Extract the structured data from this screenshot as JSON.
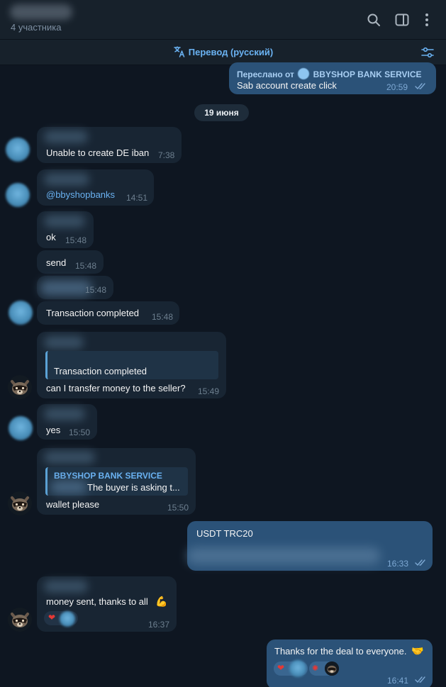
{
  "header": {
    "member_count": "4 участника",
    "icons": [
      "search-icon",
      "sidebar-toggle-icon",
      "more-vertical-icon"
    ]
  },
  "translate_bar": {
    "label": "Перевод (русский)",
    "icons": [
      "translate-icon",
      "filter-settings-icon"
    ]
  },
  "colors": {
    "background": "#0e1621",
    "incoming_bubble": "#182533",
    "outgoing_bubble": "#2b5278",
    "accent": "#6ab2f2"
  },
  "messages": {
    "fwd": {
      "prefix": "Переслано от",
      "source": "BBYSHOP BANK SERVICE",
      "text": "Sab account create click",
      "time": "20:59"
    },
    "date_separator": "19 июня",
    "m1": {
      "text": "Unable to create DE iban",
      "time": "7:38"
    },
    "m2": {
      "text": "@bbyshopbanks",
      "time": "14:51"
    },
    "m3": {
      "text": "ok",
      "time": "15:48"
    },
    "m4": {
      "text": "send",
      "time": "15:48"
    },
    "m5": {
      "time": "15:48"
    },
    "m6": {
      "text": "Transaction completed",
      "time": "15:48"
    },
    "m7": {
      "quote": "Transaction completed",
      "text": "can I transfer money to the seller?",
      "time": "15:49"
    },
    "m8": {
      "text": "yes",
      "time": "15:50"
    },
    "m9": {
      "quote_title": "BBYSHOP BANK SERVICE",
      "quote_text": "The buyer is asking t...",
      "text": "wallet please",
      "time": "15:50"
    },
    "m10": {
      "text": "USDT TRC20",
      "time": "16:33"
    },
    "m11": {
      "text": "money sent, thanks to all",
      "time": "16:37"
    },
    "m12": {
      "text": "Thanks for the deal to everyone.",
      "time": "16:41"
    }
  }
}
